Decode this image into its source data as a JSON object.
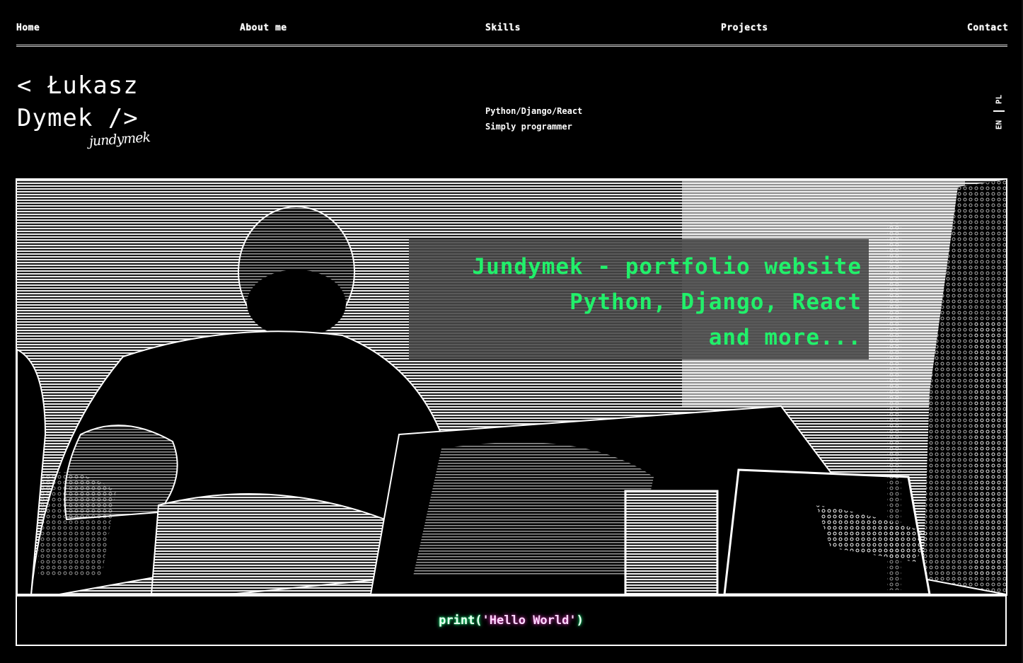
{
  "nav": {
    "items": [
      {
        "label": "Home"
      },
      {
        "label": "About me"
      },
      {
        "label": "Skills"
      },
      {
        "label": "Projects"
      },
      {
        "label": "Contact"
      }
    ]
  },
  "header": {
    "logo_line1": "< Łukasz",
    "logo_line2": "Dymek />",
    "signature": "jundymek",
    "tagline_line1": "Python/Django/React",
    "tagline_line2": "Simply programmer",
    "lang_en": "EN",
    "lang_pl": "PL"
  },
  "hero": {
    "line1": "Jundymek - portfolio website",
    "line2": "Python, Django, React",
    "line3": "and more...",
    "accent_color": "#21f06a"
  },
  "footer": {
    "code_fn": "print(",
    "code_str": "'Hello World'",
    "code_end": ")"
  }
}
